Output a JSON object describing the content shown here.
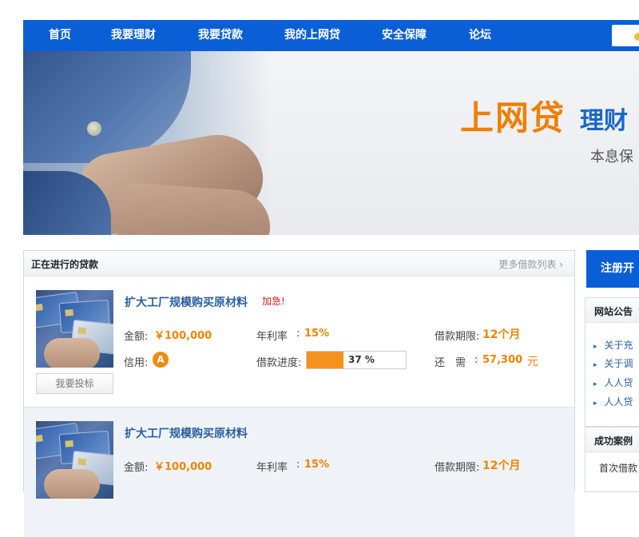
{
  "nav": {
    "items": [
      "首页",
      "我要理财",
      "我要贷款",
      "我的上网贷",
      "安全保障",
      "论坛"
    ]
  },
  "banner": {
    "brand": "上网贷",
    "tagline": "理财",
    "note": "本息保"
  },
  "loans": {
    "title": "正在进行的贷款",
    "more": "更多借款列表",
    "items": [
      {
        "title": "扩大工厂规模购买原材料",
        "badge": "加急!",
        "amount_label": "金额:",
        "amount": "￥100,000",
        "rate_label": "年利率",
        "rate": "15%",
        "term_label": "借款期限:",
        "term": "12个月",
        "credit_label": "信用:",
        "credit": "A",
        "progress_label": "借款进度:",
        "progress_pct": 37,
        "progress_text": "37 %",
        "remain_label": "还　需",
        "remain": "57,300",
        "remain_unit": "元",
        "button": "我要投标"
      },
      {
        "title": "扩大工厂规模购买原材料",
        "amount_label": "金额:",
        "amount": "￥100,000",
        "rate_label": "年利率",
        "rate": "15%",
        "term_label": "借款期限:",
        "term": "12个月"
      }
    ]
  },
  "sidebar": {
    "signup": "注册开",
    "notice_title": "网站公告",
    "notices": [
      "关于充",
      "关于调",
      "人人贷",
      "人人贷"
    ],
    "cases_title": "成功案例",
    "case_first": "首次借款"
  },
  "colors": {
    "nav_bg": "#0a5fd6",
    "brand_orange": "#f07f00",
    "brand_blue": "#1868c8",
    "value_orange": "#f08300",
    "progress_orange": "#f6921e"
  }
}
